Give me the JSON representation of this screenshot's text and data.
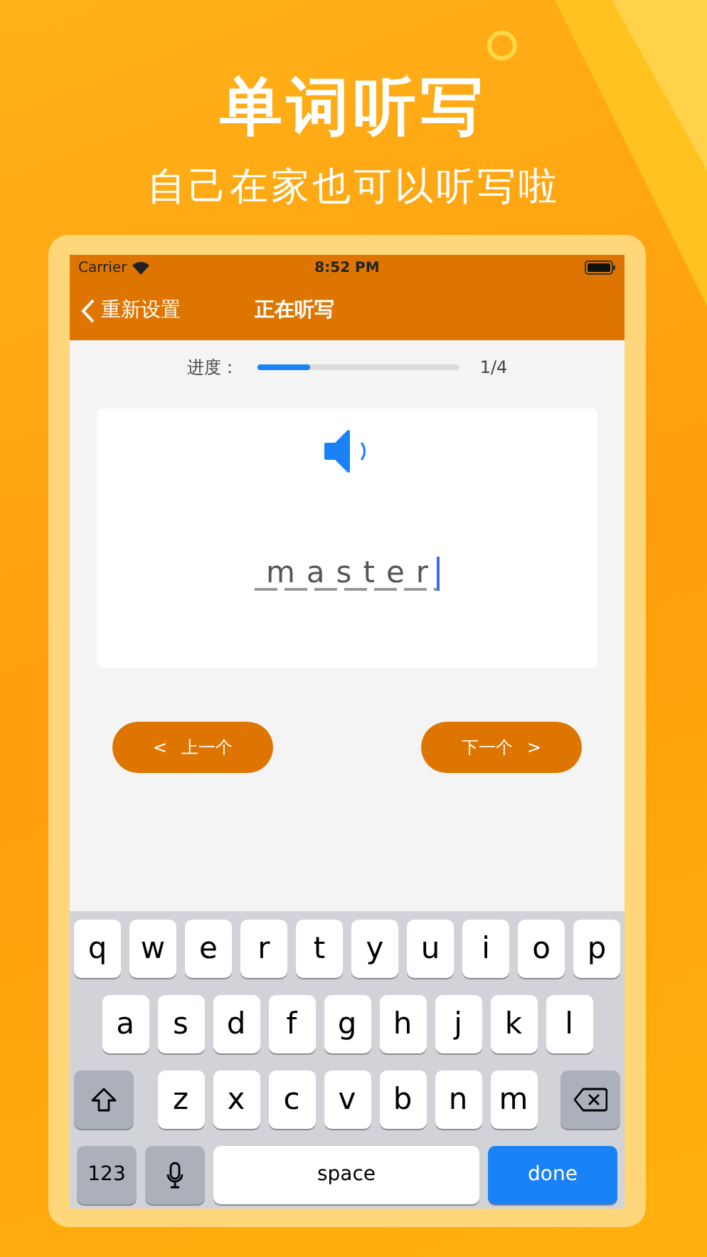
{
  "headline": "单词听写",
  "subtitle": "自己在家也可以听写啦",
  "status_bar": {
    "carrier": "Carrier",
    "time": "8:52 PM"
  },
  "nav_bar": {
    "back_label": "重新设置",
    "title": "正在听写"
  },
  "progress": {
    "label": "进度：",
    "level": 0.26,
    "reading": "1/4"
  },
  "answer": {
    "value": "master",
    "focused": true
  },
  "buttons": [
    {
      "label": "上一个",
      "arrow": "<",
      "kind": "previous"
    },
    {
      "label": "下一个",
      "arrow": ">",
      "kind": "next"
    }
  ],
  "keyboard": {
    "top_row": [
      {
        "kind": "letter",
        "label": "q"
      },
      {
        "kind": "letter",
        "label": "w"
      },
      {
        "kind": "letter",
        "label": "e"
      },
      {
        "kind": "letter",
        "label": "r"
      },
      {
        "kind": "letter",
        "label": "t"
      },
      {
        "kind": "letter",
        "label": "y"
      },
      {
        "kind": "letter",
        "label": "u"
      },
      {
        "kind": "letter",
        "label": "i"
      },
      {
        "kind": "letter",
        "label": "o"
      },
      {
        "kind": "letter",
        "label": "p"
      }
    ],
    "middle_row": [
      {
        "kind": "letter",
        "label": "a"
      },
      {
        "kind": "letter",
        "label": "s"
      },
      {
        "kind": "letter",
        "label": "d"
      },
      {
        "kind": "letter",
        "label": "f"
      },
      {
        "kind": "letter",
        "label": "g"
      },
      {
        "kind": "letter",
        "label": "h"
      },
      {
        "kind": "letter",
        "label": "j"
      },
      {
        "kind": "letter",
        "label": "k"
      },
      {
        "kind": "letter",
        "label": "l"
      }
    ],
    "lower_row": [
      {
        "kind": "shift"
      },
      {
        "kind": "letter",
        "label": "z"
      },
      {
        "kind": "letter",
        "label": "x"
      },
      {
        "kind": "letter",
        "label": "c"
      },
      {
        "kind": "letter",
        "label": "v"
      },
      {
        "kind": "letter",
        "label": "b"
      },
      {
        "kind": "letter",
        "label": "n"
      },
      {
        "kind": "letter",
        "label": "m"
      },
      {
        "kind": "delete"
      }
    ],
    "function_row": [
      {
        "kind": "numbers",
        "label": "123"
      },
      {
        "kind": "mic"
      },
      {
        "kind": "space",
        "label": "space"
      },
      {
        "kind": "done",
        "label": "done"
      }
    ]
  }
}
